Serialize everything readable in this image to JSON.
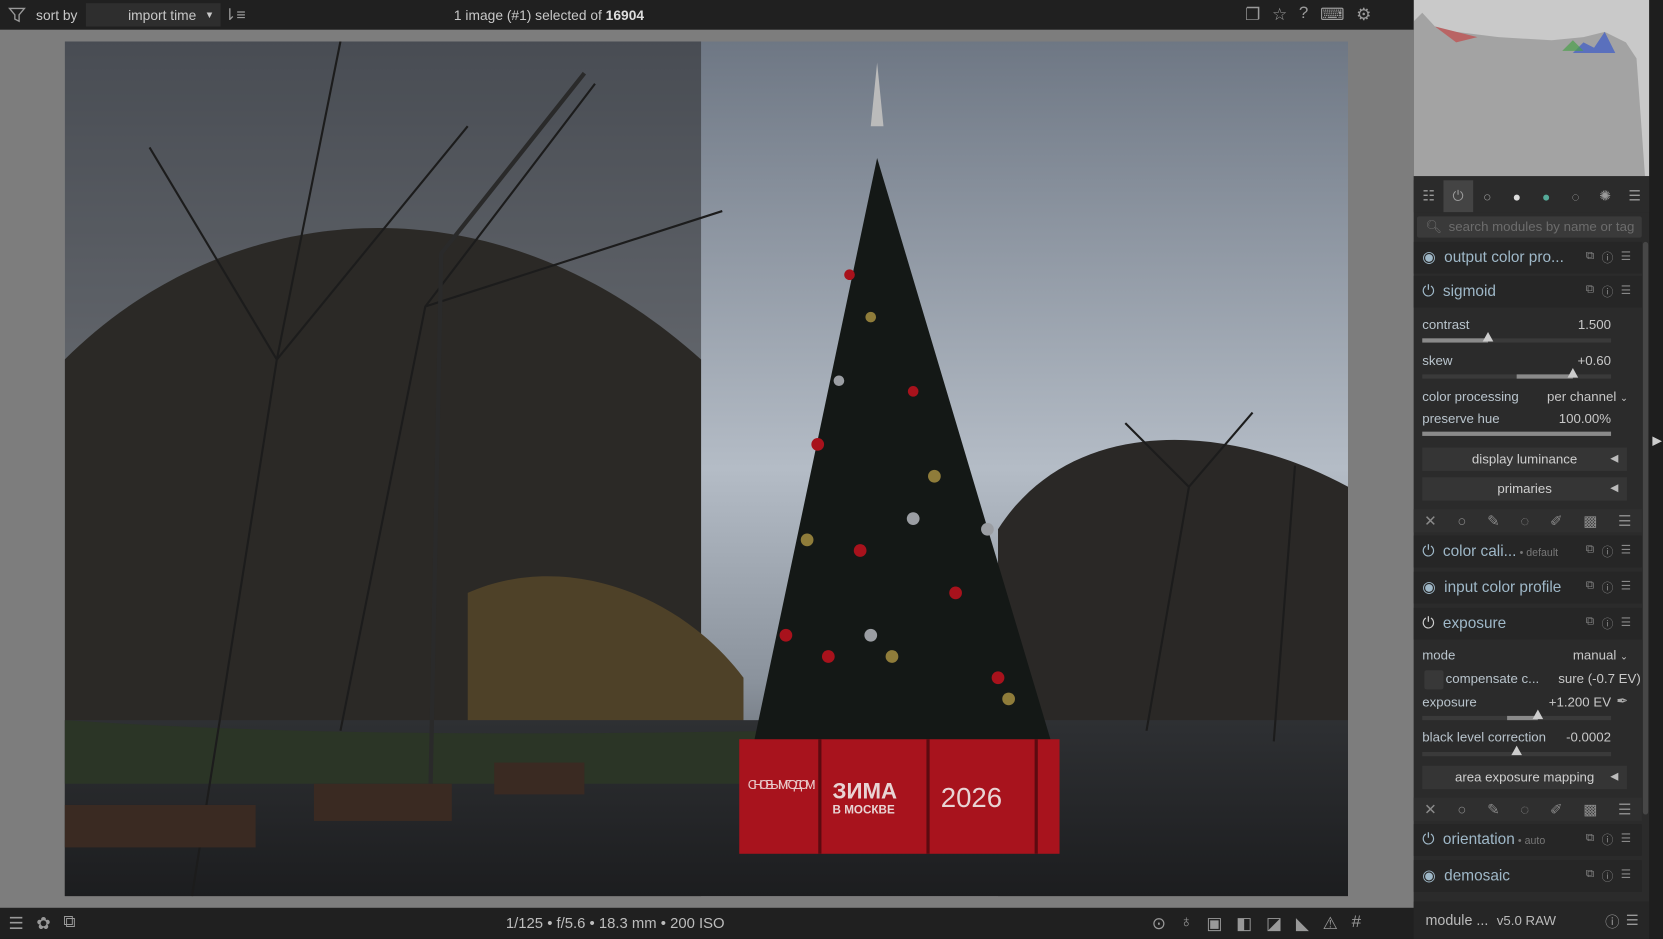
{
  "topbar": {
    "sort_by_label": "sort by",
    "sort_value": "import time",
    "selection_text": "1 image (#1) selected of ",
    "selection_total": "16904"
  },
  "photo": {
    "banner_left": "С НОВЫМ ГОДОМ!",
    "banner_mid_big": "ЗИМА",
    "banner_mid_small": "В МОСКВЕ",
    "banner_right": "2026"
  },
  "bottombar": {
    "exif": "1/125 • f/5.6 • 18.3 mm • 200 ISO"
  },
  "panel": {
    "search_placeholder": "search modules by name or tag",
    "modules": {
      "output_color": "output color pro...",
      "sigmoid": "sigmoid",
      "color_cali": "color cali...",
      "color_cali_tag": "• default",
      "input_color": "input color profile",
      "exposure": "exposure",
      "orientation": "orientation",
      "orientation_tag": "• auto",
      "demosaic": "demosaic"
    },
    "sigmoid": {
      "contrast_label": "contrast",
      "contrast_value": "1.500",
      "contrast_fraction": 0.35,
      "skew_label": "skew",
      "skew_value": "+0.60",
      "skew_fraction": 0.8,
      "color_processing_label": "color processing",
      "color_processing_value": "per channel",
      "preserve_hue_label": "preserve hue",
      "preserve_hue_value": "100.00%",
      "preserve_hue_fraction": 1.0,
      "display_luminance": "display luminance",
      "primaries": "primaries"
    },
    "exposure": {
      "mode_label": "mode",
      "mode_value": "manual",
      "compensate_label": "compensate c...",
      "compensate_value": "sure (-0.7 EV)",
      "exposure_label": "exposure",
      "exposure_value": "+1.200 EV",
      "black_label": "black level correction",
      "black_value": "-0.0002",
      "area_mapping": "area exposure mapping"
    },
    "footer_label": "module ...",
    "footer_version": "v5.0 RAW"
  }
}
